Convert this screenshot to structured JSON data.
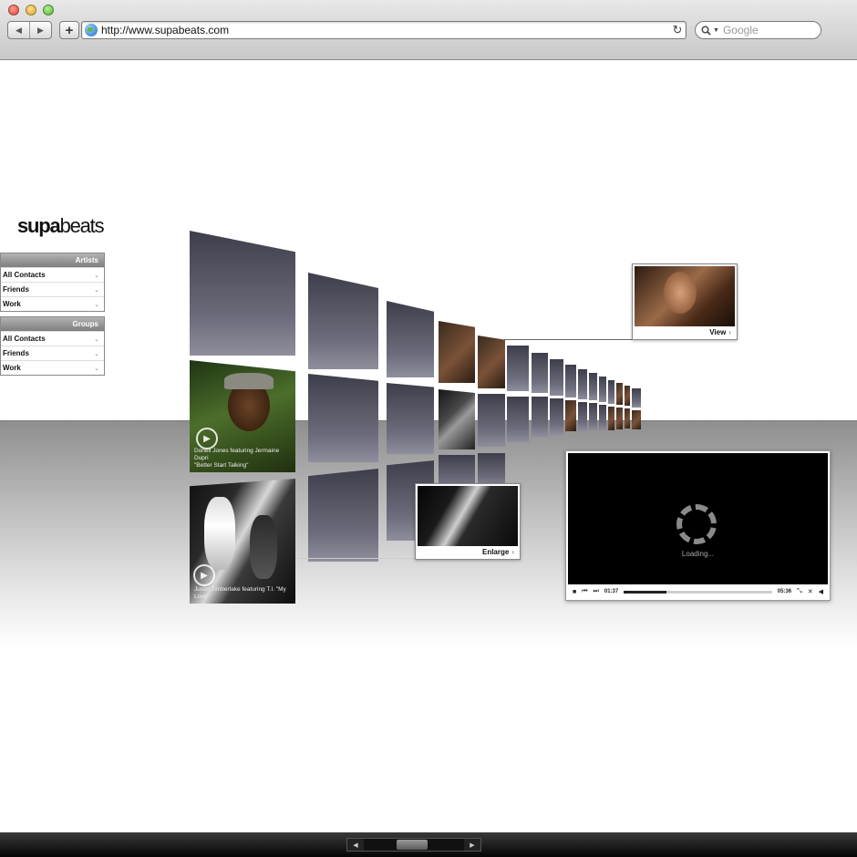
{
  "browser": {
    "back_symbol": "◀",
    "forward_symbol": "▶",
    "add_symbol": "+",
    "url": "http://www.supabeats.com",
    "reload_symbol": "↻",
    "search_placeholder": "Google",
    "search_icon": "magnifier-icon"
  },
  "logo": {
    "bold": "supa",
    "light": "beats"
  },
  "panels": [
    {
      "title": "Artists",
      "items": [
        {
          "label": "All Contacts"
        },
        {
          "label": "Friends"
        },
        {
          "label": "Work"
        }
      ]
    },
    {
      "title": "Groups",
      "items": [
        {
          "label": "All Contacts"
        },
        {
          "label": "Friends"
        },
        {
          "label": "Work"
        }
      ]
    }
  ],
  "videos": [
    {
      "caption_line1": "Donell Jones featuring Jermaine Dupri",
      "caption_line2": "\"Better Start Talking\""
    },
    {
      "caption_line1": "Justin Timberlake featuring T.I. \"My Love\"",
      "caption_line2": ""
    }
  ],
  "popups": {
    "view_label": "View",
    "enlarge_label": "Enlarge",
    "arrow": "›"
  },
  "player": {
    "loading": "Loading...",
    "time_current": "01:37",
    "time_total": "05:36",
    "progress_fraction": 0.29,
    "stop_symbol": "■",
    "prev_symbol": "⏮",
    "next_symbol": "⏭",
    "shrink_symbol": "⤡",
    "fullscreen_symbol": "✕",
    "volume_symbol": "◀"
  },
  "scrollbar": {
    "left_symbol": "◀",
    "right_symbol": "▶"
  },
  "colors": {
    "tile_dark": "#3e3e4b",
    "tile_light": "#8e8e9d",
    "panel_header": "#9a9a9a",
    "player_bg": "#000000"
  }
}
